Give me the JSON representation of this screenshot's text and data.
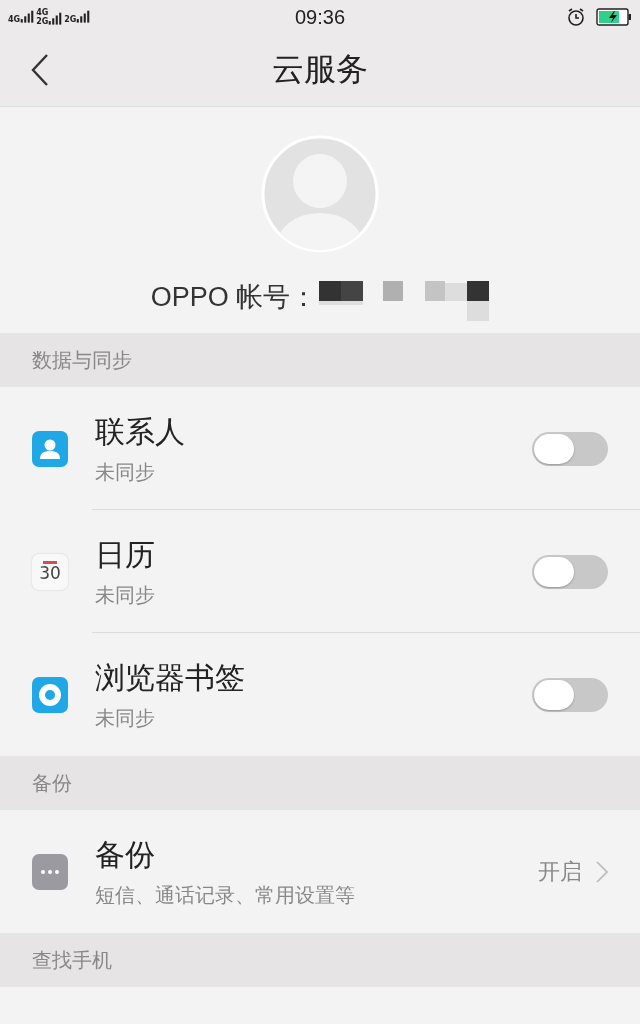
{
  "status_bar": {
    "network_labels": [
      {
        "top": "4G"
      },
      {
        "top": "4G",
        "bottom": "2G"
      },
      {
        "top": "2G"
      }
    ],
    "time": "09:36",
    "charging": true
  },
  "header": {
    "title": "云服务"
  },
  "account": {
    "label": "OPPO 帐号：",
    "redacted": true
  },
  "sections": [
    {
      "title": "数据与同步",
      "items": [
        {
          "kind": "toggle",
          "title": "联系人",
          "subtitle": "未同步",
          "on": false
        },
        {
          "kind": "toggle",
          "icon_text": "30",
          "title": "日历",
          "subtitle": "未同步",
          "on": false
        },
        {
          "kind": "toggle",
          "title": "浏览器书签",
          "subtitle": "未同步",
          "on": false
        }
      ]
    },
    {
      "title": "备份",
      "items": [
        {
          "kind": "link",
          "title": "备份",
          "subtitle": "短信、通话记录、常用设置等",
          "value": "开启"
        }
      ]
    },
    {
      "title": "查找手机",
      "items": [
        {
          "kind": "cut"
        }
      ]
    }
  ]
}
